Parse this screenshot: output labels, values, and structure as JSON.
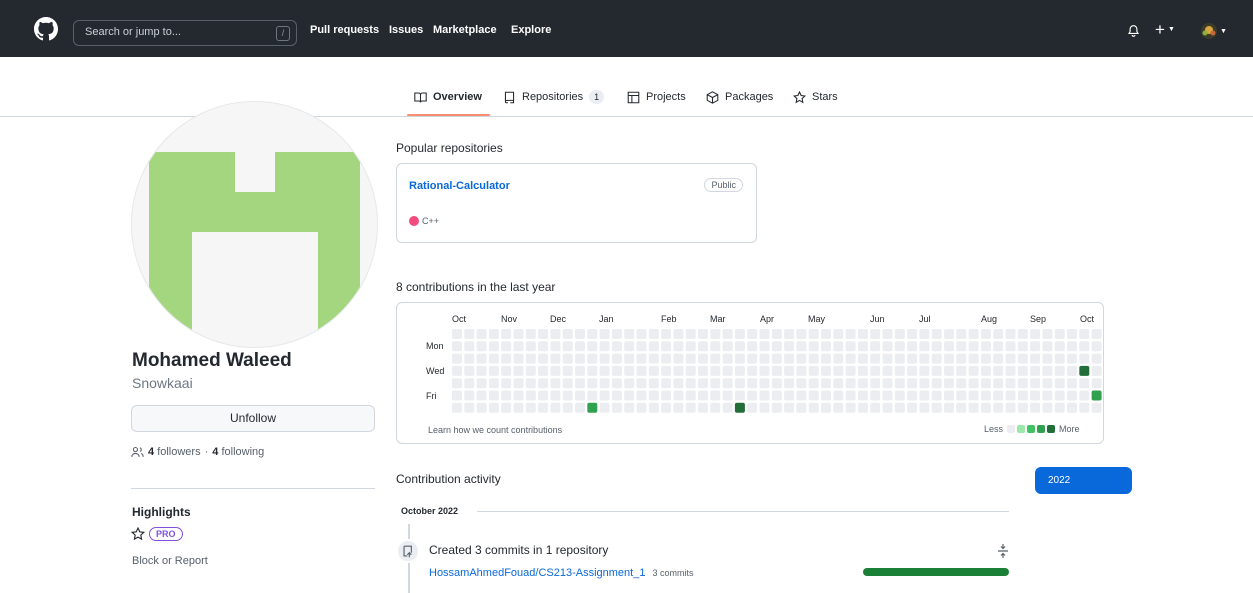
{
  "header": {
    "search_placeholder": "Search or jump to...",
    "search_shortcut": "/",
    "nav": [
      "Pull requests",
      "Issues",
      "Marketplace",
      "Explore"
    ]
  },
  "tabs": [
    {
      "label": "Overview",
      "icon": "book-icon"
    },
    {
      "label": "Repositories",
      "count": "1",
      "icon": "repo-icon"
    },
    {
      "label": "Projects",
      "icon": "table-icon"
    },
    {
      "label": "Packages",
      "icon": "package-icon"
    },
    {
      "label": "Stars",
      "icon": "star-icon"
    }
  ],
  "profile": {
    "name": "Mohamed Waleed",
    "login": "Snowkaai",
    "unfollow_label": "Unfollow",
    "followers_count": "4",
    "followers_label": "followers",
    "separator": "·",
    "following_count": "4",
    "following_label": "following",
    "highlights_title": "Highlights",
    "pro_badge": "PRO",
    "block_label": "Block or Report"
  },
  "popular": {
    "title": "Popular repositories",
    "repos": [
      {
        "name": "Rational-Calculator",
        "visibility": "Public",
        "language": "C++",
        "language_color": "#f34b7d"
      }
    ]
  },
  "contributions": {
    "title": "8 contributions in the last year",
    "months": [
      "Oct",
      "Nov",
      "Dec",
      "Jan",
      "Feb",
      "Mar",
      "Apr",
      "May",
      "Jun",
      "Jul",
      "Aug",
      "Sep",
      "Oct"
    ],
    "day_labels": [
      "Mon",
      "Wed",
      "Fri"
    ],
    "learn_link": "Learn how we count contributions",
    "legend_less": "Less",
    "legend_more": "More",
    "levels_colors": [
      "#ebedf0",
      "#9be9a8",
      "#40c463",
      "#30a14e",
      "#216e39"
    ],
    "weeks": 53,
    "active_cells": [
      {
        "week": 11,
        "day": 6,
        "level": 3
      },
      {
        "week": 23,
        "day": 6,
        "level": 4
      },
      {
        "week": 51,
        "day": 3,
        "level": 4
      },
      {
        "week": 52,
        "day": 5,
        "level": 3
      }
    ]
  },
  "activity": {
    "title": "Contribution activity",
    "year": "2022",
    "month_header": "October 2022",
    "entry_title": "Created 3 commits in 1 repository",
    "repo": "HossamAhmedFouad/CS213-Assignment_1",
    "repo_commits": "3 commits",
    "repo_share": 1.0
  },
  "colors": {
    "header_bg": "#24292f",
    "accent": "#0969da",
    "tab_underline": "#fd8c73",
    "avatar_green": "#a4d67f"
  }
}
